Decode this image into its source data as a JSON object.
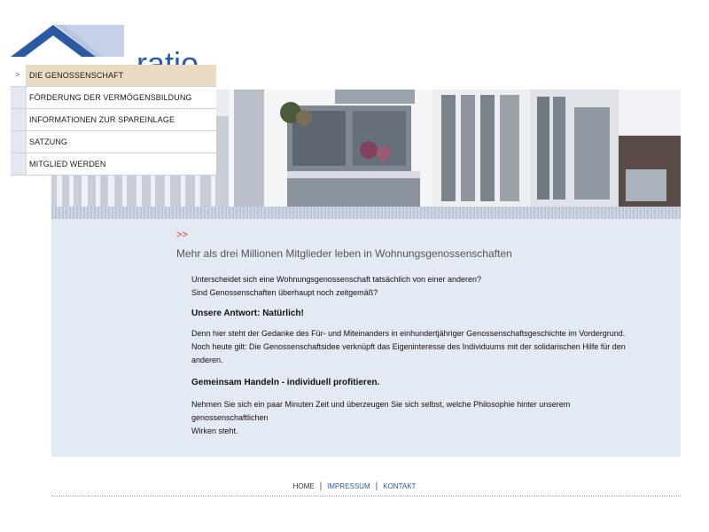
{
  "brand": {
    "name": "ratio",
    "color": "#2b5aa3"
  },
  "nav": {
    "items": [
      {
        "label": "DIE GENOSSENSCHAFT",
        "active": true,
        "marker": ">"
      },
      {
        "label": "FÖRDERUNG DER VERMÖGENSBILDUNG",
        "active": false
      },
      {
        "label": "INFORMATIONEN ZUR SPAREINLAGE",
        "active": false
      },
      {
        "label": "SATZUNG",
        "active": false
      },
      {
        "label": "MITGLIED WERDEN",
        "active": false
      }
    ]
  },
  "content": {
    "marker": ">>",
    "heading": "Mehr als drei Millionen Mitglieder leben in Wohnungsgenossenschaften",
    "intro": [
      "Unterscheidet sich eine Wohnungsgenossenschaft tatsächlich von einer anderen?",
      "Sind Genossenschaften überhaupt noch zeitgemäß?"
    ],
    "answer_heading": "Unsere Antwort: Natürlich!",
    "paragraph2": [
      "Denn hier steht der Gedanke des Für- und Miteinanders in einhundertjähriger Genossenschaftsgeschichte im Vordergrund.",
      "Noch heute gilt: Die Genossenschaftsidee verknüpft das Eigeninteresse des Individuums mit der solidarischen Hilfe für den",
      "anderen."
    ],
    "slogan": "Gemeinsam Handeln - individuell profitieren.",
    "paragraph3": [
      "Nehmen Sie sich ein paar Minuten Zeit und überzeugen Sie sich selbst, welche Philosophie hinter unserem genossenschaftlichen",
      "Wirken steht."
    ]
  },
  "footer": {
    "home": "HOME",
    "impressum": "IMPRESSUM",
    "kontakt": "KONTAKT",
    "separator": "|"
  },
  "icons": {
    "logo": "roof-logo-icon",
    "nav_marker": "chevron-right-icon"
  },
  "colors": {
    "accent_red": "#d23a3a",
    "panel_bg": "#e4eaf3",
    "active_nav_bg": "#eadcc3"
  }
}
